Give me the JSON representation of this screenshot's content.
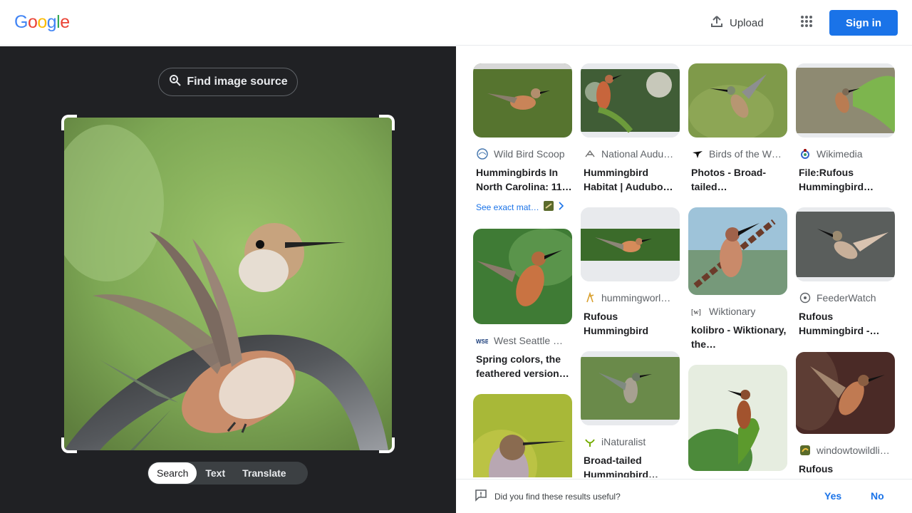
{
  "header": {
    "logo_letters": [
      {
        "char": "G",
        "color": "#4285f4"
      },
      {
        "char": "o",
        "color": "#ea4335"
      },
      {
        "char": "o",
        "color": "#fbbc05"
      },
      {
        "char": "g",
        "color": "#4285f4"
      },
      {
        "char": "l",
        "color": "#34a853"
      },
      {
        "char": "e",
        "color": "#ea4335"
      }
    ],
    "upload_label": "Upload",
    "upload_icon": "upload-icon",
    "apps_icon": "apps-grid-icon",
    "signin_label": "Sign in"
  },
  "left_panel": {
    "find_source_label": "Find image source",
    "find_source_icon": "lens-search-icon",
    "tabs": [
      {
        "label": "Search",
        "active": true
      },
      {
        "label": "Text",
        "active": false
      },
      {
        "label": "Translate",
        "active": false
      }
    ]
  },
  "results": {
    "col1": [
      {
        "source": "Wild Bird Scoop",
        "title": "Hummingbirds In North Carolina: 11…",
        "exact_match_label": "See exact mat…"
      },
      {
        "source": "West Seattle B…",
        "title": "Spring colors, the feathered version…"
      },
      {
        "source": "",
        "title": ""
      }
    ],
    "col2": [
      {
        "source": "National Audu…",
        "title": "Hummingbird Habitat | Audubo…"
      },
      {
        "source": "hummingworl…",
        "title": "Rufous Hummingbird"
      },
      {
        "source": "iNaturalist",
        "title": "Broad-tailed Hummingbird…"
      }
    ],
    "col3": [
      {
        "source": "Birds of the W…",
        "title": "Photos - Broad-tailed…"
      },
      {
        "source": "Wiktionary",
        "title": "kolibro - Wiktionary, the…"
      },
      {
        "source": "",
        "title": ""
      }
    ],
    "col4": [
      {
        "source": "Wikimedia",
        "title": "File:Rufous Hummingbird…"
      },
      {
        "source": "FeederWatch",
        "title": "Rufous Hummingbird -…"
      },
      {
        "source": "windowtowildli…",
        "title": "Rufous"
      }
    ]
  },
  "feedback": {
    "question": "Did you find these results useful?",
    "yes_label": "Yes",
    "no_label": "No"
  }
}
